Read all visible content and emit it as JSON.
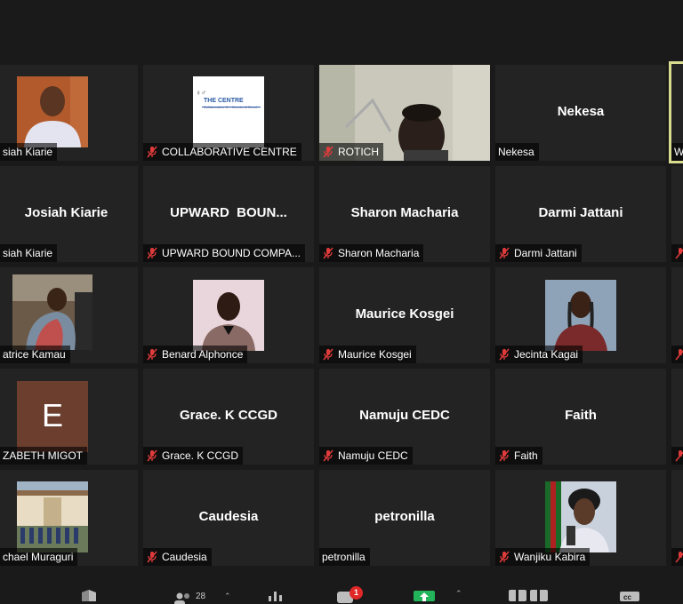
{
  "participants_count": "28",
  "chat_badge": "1",
  "colors": {
    "accent_active": "#d7dc8f",
    "mute": "#e03b3b",
    "tile_bg": "#232323"
  },
  "tiles": [
    {
      "name": "Josiah Kiarie",
      "label": "siah Kiarie",
      "muted": false,
      "type": "photo"
    },
    {
      "name": "COLLABORATIVE CENTRE",
      "label": "COLLABORATIVE CENTRE",
      "muted": true,
      "type": "logo",
      "logo_title": "THE CENTRE",
      "logo_sub": "Collaborative C... Gender & Devel..."
    },
    {
      "name": "ROTICH",
      "label": "ROTICH",
      "muted": true,
      "type": "video"
    },
    {
      "name": "Nekesa",
      "label": "Nekesa",
      "muted": false,
      "type": "name",
      "center": "Nekesa"
    },
    {
      "name": "Josiah Kiarie",
      "label": "siah Kiarie",
      "muted": false,
      "type": "name",
      "center": "Josiah Kiarie"
    },
    {
      "name": "UPWARD BOUND COMPANY",
      "label": "UPWARD BOUND COMPA...",
      "muted": true,
      "type": "name",
      "center": "UPWARD  BOUN..."
    },
    {
      "name": "Sharon Macharia",
      "label": "Sharon Macharia",
      "muted": true,
      "type": "name",
      "center": "Sharon Macharia"
    },
    {
      "name": "Darmi Jattani",
      "label": "Darmi Jattani",
      "muted": true,
      "type": "name",
      "center": "Darmi Jattani"
    },
    {
      "name": "Beatrice Kamau",
      "label": "atrice Kamau",
      "muted": false,
      "type": "photo"
    },
    {
      "name": "Benard Alphonce",
      "label": "Benard Alphonce",
      "muted": true,
      "type": "photo"
    },
    {
      "name": "Maurice Kosgei",
      "label": "Maurice Kosgei",
      "muted": true,
      "type": "name",
      "center": "Maurice Kosgei"
    },
    {
      "name": "Jecinta Kagai",
      "label": "Jecinta Kagai",
      "muted": true,
      "type": "photo"
    },
    {
      "name": "ELIZABETH MIGOT",
      "label": "ZABETH MIGOT",
      "muted": false,
      "type": "letter",
      "letter": "E"
    },
    {
      "name": "Grace. K CCGD",
      "label": "Grace. K CCGD",
      "muted": true,
      "type": "name",
      "center": "Grace. K CCGD"
    },
    {
      "name": "Namuju CEDC",
      "label": "Namuju CEDC",
      "muted": true,
      "type": "name",
      "center": "Namuju CEDC"
    },
    {
      "name": "Faith",
      "label": "Faith",
      "muted": true,
      "type": "name",
      "center": "Faith"
    },
    {
      "name": "Michael Muraguri",
      "label": "chael Muraguri",
      "muted": false,
      "type": "photo"
    },
    {
      "name": "Caudesia",
      "label": "Caudesia",
      "muted": true,
      "type": "name",
      "center": "Caudesia"
    },
    {
      "name": "petronilla",
      "label": "petronilla",
      "muted": false,
      "type": "name",
      "center": "petronilla"
    },
    {
      "name": "Wanjiku Kabira",
      "label": "Wanjiku Kabira",
      "muted": true,
      "type": "photo"
    }
  ],
  "edge_tiles": [
    {
      "label": "W"
    }
  ]
}
